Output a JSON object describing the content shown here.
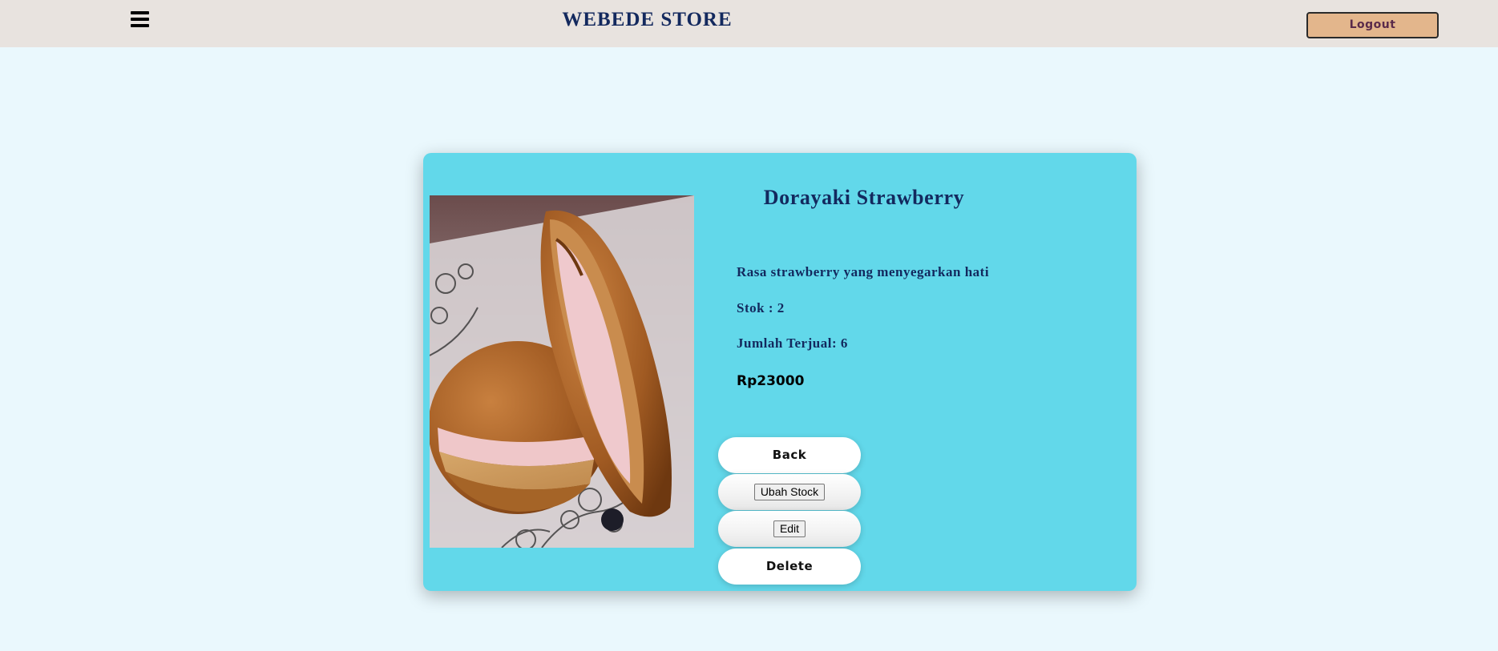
{
  "navbar": {
    "brand": "WEBEDE STORE",
    "logout_label": "Logout"
  },
  "product": {
    "name": "Dorayaki Strawberry",
    "description": "Rasa strawberry yang menyegarkan hati",
    "stock_text": "Stok : 2",
    "sold_text": "Jumlah Terjual: 6",
    "price_text": "Rp23000"
  },
  "actions": {
    "back_label": "Back",
    "change_stock_label": "Ubah Stock",
    "edit_label": "Edit",
    "delete_label": "Delete"
  },
  "colors": {
    "navbar_bg": "#e8e3df",
    "page_bg": "#eaf8fd",
    "card_bg": "#62d8ea",
    "title_text": "#13295e",
    "logout_bg": "#e3b68c"
  },
  "icons": {
    "menu": "hamburger-menu-icon"
  }
}
